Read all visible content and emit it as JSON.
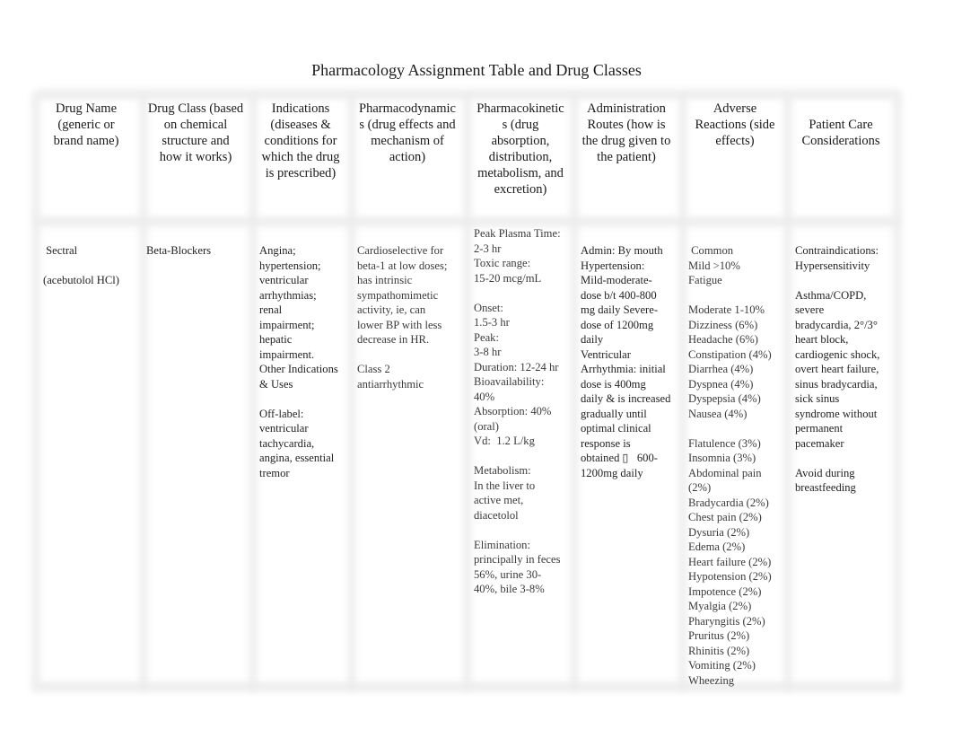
{
  "document": {
    "title": "Pharmacology Assignment Table and Drug Classes"
  },
  "table": {
    "headers": [
      "Drug Name\n(generic or\nbrand name)",
      "Drug Class (based\non chemical\nstructure and\nhow it works)",
      "Indications\n(diseases &\nconditions for\nwhich the drug\nis prescribed)",
      "Pharmacodynamic\ns (drug effects and\nmechanism of\naction)",
      "Pharmacokinetic\ns (drug\nabsorption,\ndistribution,\nmetabolism, and\nexcretion)",
      "Administration\nRoutes (how is\nthe drug given to\nthe patient)",
      "Adverse\nReactions   (side\neffects)",
      "Patient Care\nConsiderations"
    ],
    "row": {
      "drug_name": " Sectral\n\n(acebutolol HCl)",
      "drug_class": "Beta-Blockers",
      "indications": "Angina;\nhypertension;\nventricular\narrhythmias;\nrenal\nimpairment;\nhepatic\nimpairment.\nOther Indications\n& Uses\n\nOff-label:\nventricular\ntachycardia,\nangina, essential\ntremor",
      "pharmacodynamics": "Cardioselective for\nbeta-1 at low doses;\nhas intrinsic\nsympathomimetic\nactivity, ie, can\nlower BP with less\ndecrease in HR.\n\nClass 2\nantiarrhythmic",
      "pharmacokinetics": "Peak Plasma Time:\n2-3 hr\nToxic range:\n15-20 mcg/mL\n\nOnset:\n1.5-3 hr\nPeak:\n3-8 hr\nDuration: 12-24 hr\nBioavailability:\n40%\nAbsorption: 40%\n(oral)\nVd:  1.2 L/kg\n\nMetabolism:\nIn the liver to\nactive met,\ndiacetolol\n\nElimination:\nprincipally in feces\n56%, urine 30-\n40%, bile 3-8%",
      "administration": "Admin: By mouth\nHypertension:\nMild-moderate-\ndose b/t 400-800\nmg daily Severe-\ndose of 1200mg\ndaily\nVentricular\nArrhythmia: initial\ndose is 400mg\ndaily & is increased\ngradually until\noptimal clinical\nresponse is\nobtained ▯   600-\n1200mg daily",
      "adverse_reactions": " Common\nMild >10%\nFatigue\n\nModerate 1-10%\nDizziness (6%)\nHeadache (6%)\nConstipation (4%)\nDiarrhea (4%)\nDyspnea (4%)\nDyspepsia (4%)\nNausea (4%)\n\nFlatulence (3%)\nInsomnia (3%)\nAbdominal pain\n(2%)\nBradycardia (2%)\nChest pain (2%)\nDysuria (2%)\nEdema (2%)\nHeart failure (2%)\nHypotension (2%)\nImpotence (2%)\nMyalgia (2%)\nPharyngitis (2%)\nPruritus (2%)\nRhinitis (2%)\nVomiting (2%)\nWheezing",
      "patient_care": "Contraindications:\nHypersensitivity\n\nAsthma/COPD,\nsevere\nbradycardia, 2°/3°\nheart block,\ncardiogenic shock,\novert heart failure,\nsinus bradycardia,\nsick sinus\nsyndrome without\npermanent\npacemaker\n\nAvoid during\nbreastfeeding"
    }
  }
}
